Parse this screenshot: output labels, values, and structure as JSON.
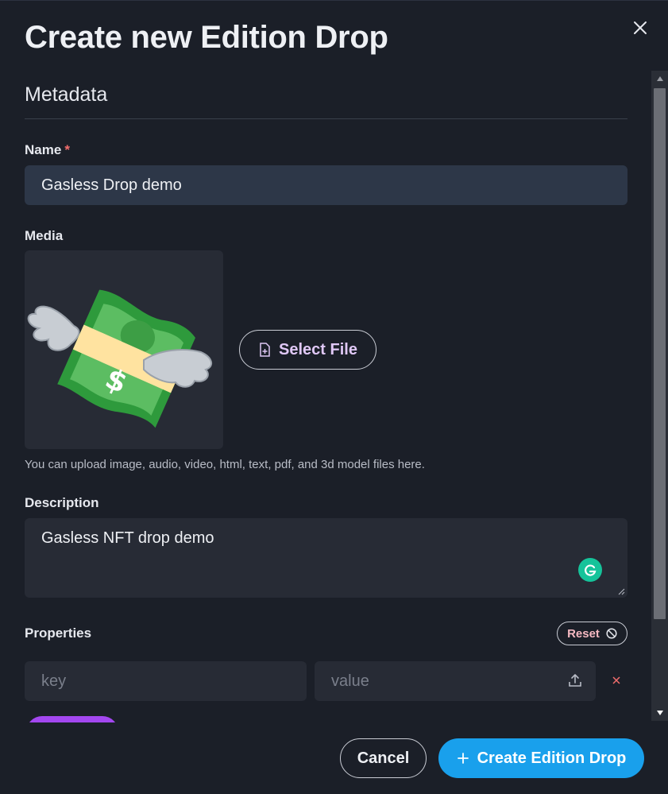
{
  "modal": {
    "title": "Create new Edition Drop"
  },
  "metadata": {
    "section_title": "Metadata",
    "name_label": "Name",
    "name_required_mark": "*",
    "name_value": "Gasless Drop demo",
    "media_label": "Media",
    "select_file_label": "Select File",
    "media_hint": "You can upload image, audio, video, html, text, pdf, and 3d model files here.",
    "description_label": "Description",
    "description_value": "Gasless NFT drop demo",
    "properties_label": "Properties",
    "reset_label": "Reset",
    "property_key_placeholder": "key",
    "property_value_placeholder": "value"
  },
  "footer": {
    "cancel_label": "Cancel",
    "create_label": "Create Edition Drop"
  },
  "colors": {
    "background": "#1b1f28",
    "input_active": "#2d3748",
    "input": "#272b35",
    "primary": "#19a0ec",
    "add_button": "#a347f0",
    "required": "#f26d6d",
    "grammarly": "#15c39a"
  },
  "icons": {
    "close": "close-icon",
    "file": "file-plus-icon",
    "media_preview": "money-with-wings-icon",
    "grammarly": "grammarly-icon",
    "reset": "ban-icon",
    "upload": "upload-icon",
    "remove": "close-small-icon",
    "plus": "plus-icon"
  }
}
